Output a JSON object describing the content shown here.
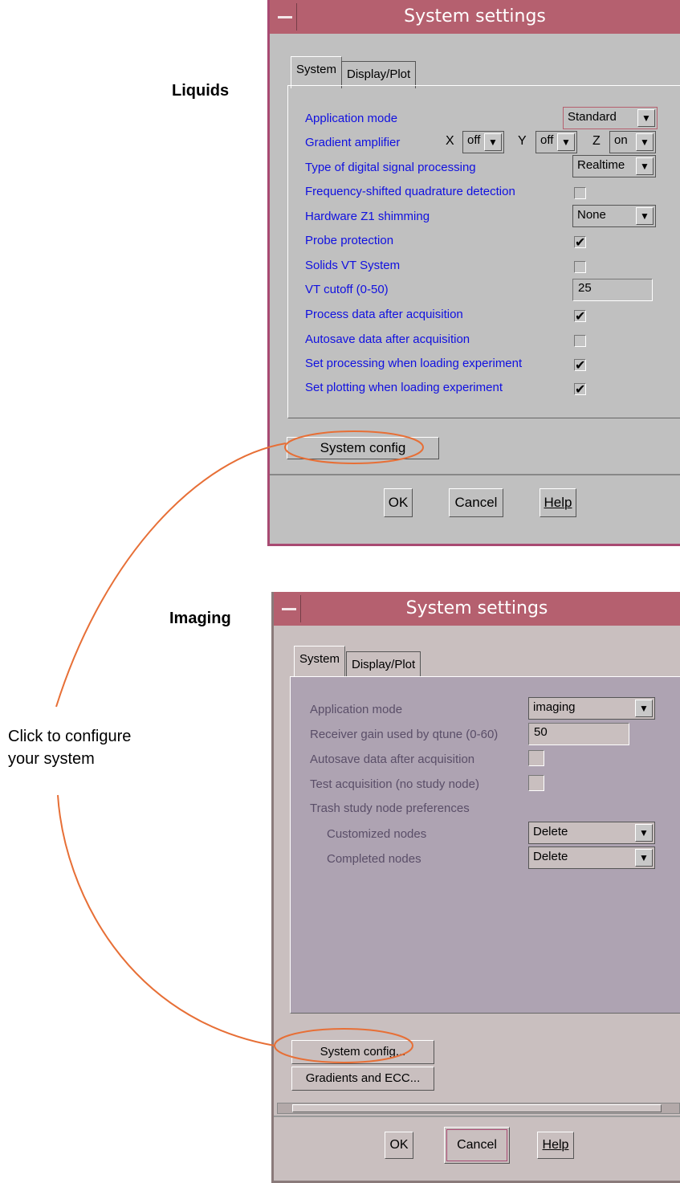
{
  "labels": {
    "liquids": "Liquids",
    "imaging": "Imaging",
    "callout_line1": "Click to configure",
    "callout_line2": "your system"
  },
  "colors": {
    "titlebar": "#b5606f",
    "liquids_bg": "#c0c0c0",
    "imaging_bg": "#c9bfbf",
    "imaging_panel": "#aea3b2",
    "liquids_label": "#1010e0",
    "imaging_label": "#5a4e68",
    "callout": "#e76f36",
    "frame": "#a84a72"
  },
  "liquids": {
    "title": "System settings",
    "tabs": [
      "System",
      "Display/Plot"
    ],
    "settings": {
      "application_mode": {
        "label": "Application mode",
        "value": "Standard"
      },
      "gradient_amplifier": {
        "label": "Gradient amplifier",
        "x_label": "X",
        "x_value": "off",
        "y_label": "Y",
        "y_value": "off",
        "z_label": "Z",
        "z_value": "on"
      },
      "dsp_type": {
        "label": "Type of digital signal processing",
        "value": "Realtime"
      },
      "fsqd": {
        "label": "Frequency-shifted quadrature detection",
        "checked": false
      },
      "z1_shimming": {
        "label": "Hardware Z1 shimming",
        "value": "None"
      },
      "probe_protection": {
        "label": "Probe protection",
        "checked": true
      },
      "solids_vt": {
        "label": "Solids VT System",
        "checked": false
      },
      "vt_cutoff": {
        "label": "VT cutoff (0-50)",
        "value": "25"
      },
      "process_data": {
        "label": "Process data after acquisition",
        "checked": true
      },
      "autosave": {
        "label": "Autosave data after acquisition",
        "checked": false
      },
      "set_processing": {
        "label": "Set processing when loading experiment",
        "checked": true
      },
      "set_plotting": {
        "label": "Set plotting when loading experiment",
        "checked": true
      }
    },
    "system_config_button": "System config",
    "buttons": {
      "ok": "OK",
      "cancel": "Cancel",
      "help": "Help"
    }
  },
  "imaging": {
    "title": "System settings",
    "tabs": [
      "System",
      "Display/Plot"
    ],
    "settings": {
      "application_mode": {
        "label": "Application mode",
        "value": "imaging"
      },
      "receiver_gain": {
        "label": "Receiver gain used by qtune (0-60)",
        "value": "50"
      },
      "autosave": {
        "label": "Autosave data after acquisition",
        "checked": false
      },
      "test_acquisition": {
        "label": "Test acquisition (no study node)",
        "checked": false
      },
      "trash_prefs": {
        "label": "Trash study node preferences"
      },
      "customized_nodes": {
        "label": "Customized nodes",
        "value": "Delete"
      },
      "completed_nodes": {
        "label": "Completed nodes",
        "value": "Delete"
      }
    },
    "system_config_button": "System config...",
    "gradients_button": "Gradients and ECC...",
    "buttons": {
      "ok": "OK",
      "cancel": "Cancel",
      "help": "Help"
    }
  }
}
